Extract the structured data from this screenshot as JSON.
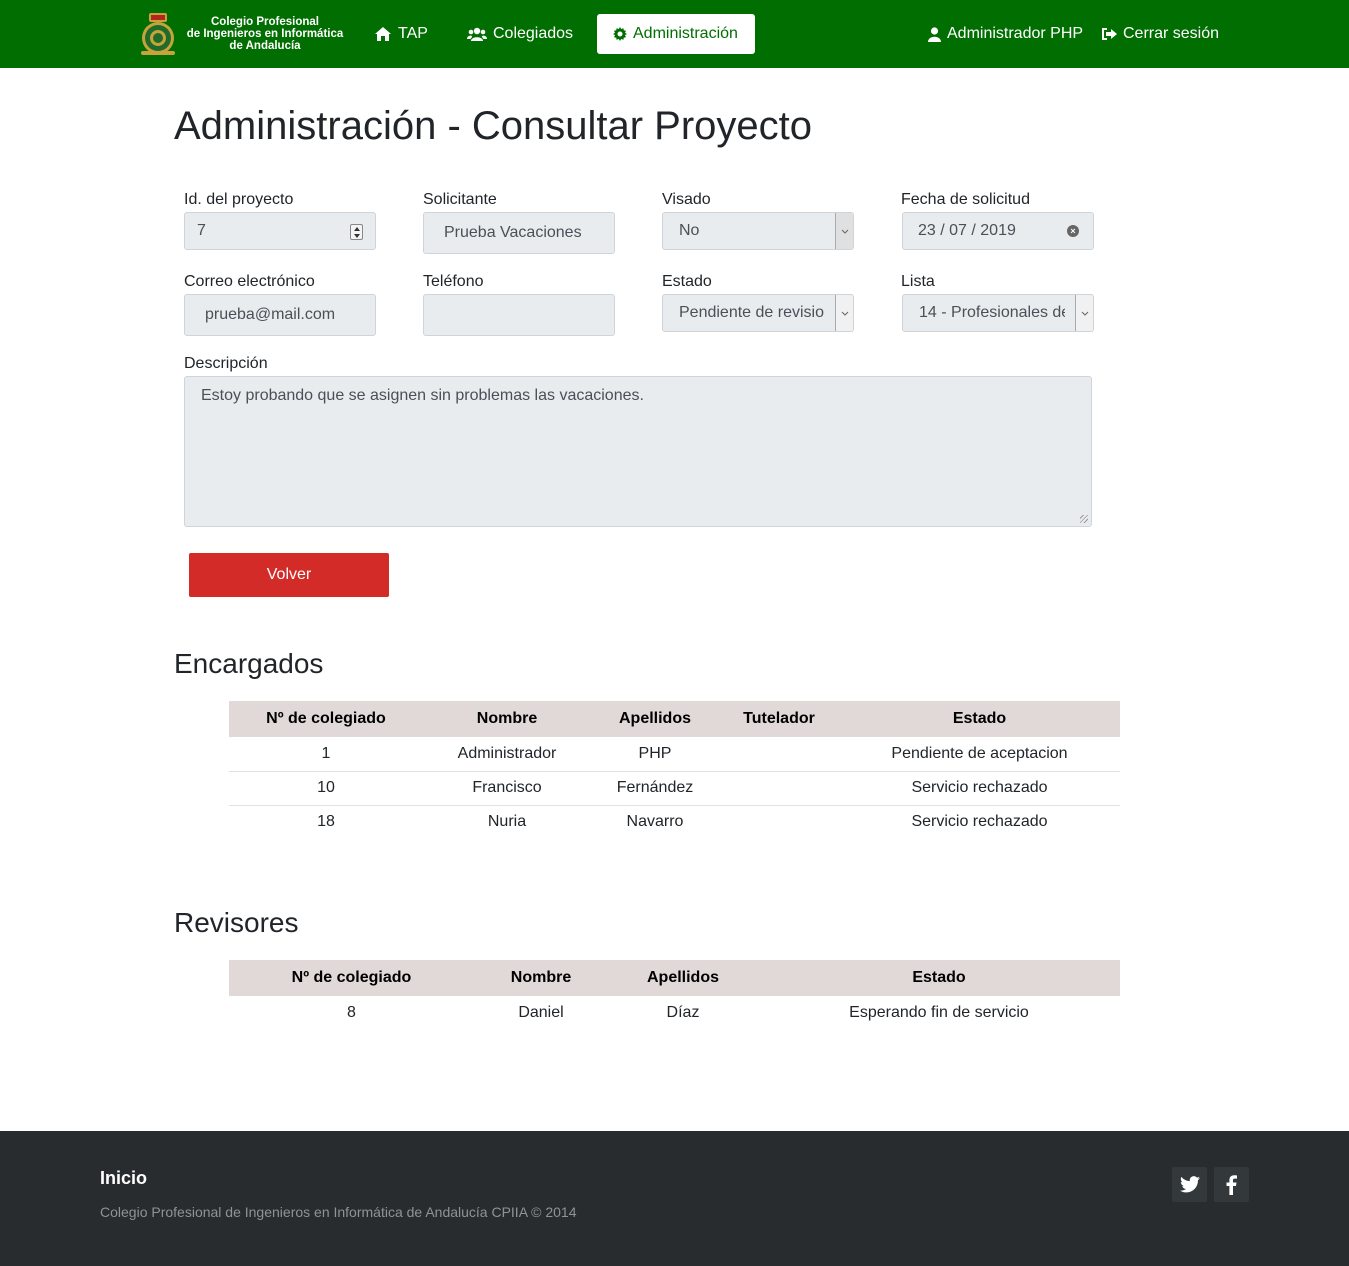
{
  "navbar": {
    "brand_line1": "Colegio Profesional",
    "brand_line2": "de Ingenieros en Informática",
    "brand_line3": "de Andalucía",
    "tap": "TAP",
    "colegiados": "Colegiados",
    "administracion": "Administración",
    "user": "Administrador PHP",
    "logout": "Cerrar sesión",
    "brand_color": "#006e00"
  },
  "page": {
    "title": "Administración - Consultar Proyecto"
  },
  "form": {
    "id_label": "Id. del proyecto",
    "id_value": "7",
    "solicitante_label": "Solicitante",
    "solicitante_value": "Prueba Vacaciones",
    "visado_label": "Visado",
    "visado_value": "No",
    "fecha_label": "Fecha de solicitud",
    "fecha_value": "23 / 07 / 2019",
    "correo_label": "Correo electrónico",
    "correo_value": "prueba@mail.com",
    "telefono_label": "Teléfono",
    "telefono_value": "",
    "estado_label": "Estado",
    "estado_value": "Pendiente de revision",
    "lista_label": "Lista",
    "lista_value": "14 - Profesionales de",
    "descripcion_label": "Descripción",
    "descripcion_value": "Estoy probando que se asignen sin problemas las vacaciones.",
    "volver": "Volver",
    "volver_color": "#d32b28"
  },
  "encargados": {
    "title": "Encargados",
    "headers": [
      "Nº de colegiado",
      "Nombre",
      "Apellidos",
      "Tutelador",
      "Estado"
    ],
    "rows": [
      [
        "1",
        "Administrador",
        "PHP",
        "",
        "Pendiente de aceptacion"
      ],
      [
        "10",
        "Francisco",
        "Fernández",
        "",
        "Servicio rechazado"
      ],
      [
        "18",
        "Nuria",
        "Navarro",
        "",
        "Servicio rechazado"
      ]
    ]
  },
  "revisores": {
    "title": "Revisores",
    "headers": [
      "Nº de colegiado",
      "Nombre",
      "Apellidos",
      "Estado"
    ],
    "rows": [
      [
        "8",
        "Daniel",
        "Díaz",
        "Esperando fin de servicio"
      ]
    ]
  },
  "footer": {
    "title": "Inicio",
    "copyright": "Colegio Profesional de Ingenieros en Informática de Andalucía CPIIA © 2014",
    "social": [
      "twitter-icon",
      "facebook-icon"
    ]
  }
}
